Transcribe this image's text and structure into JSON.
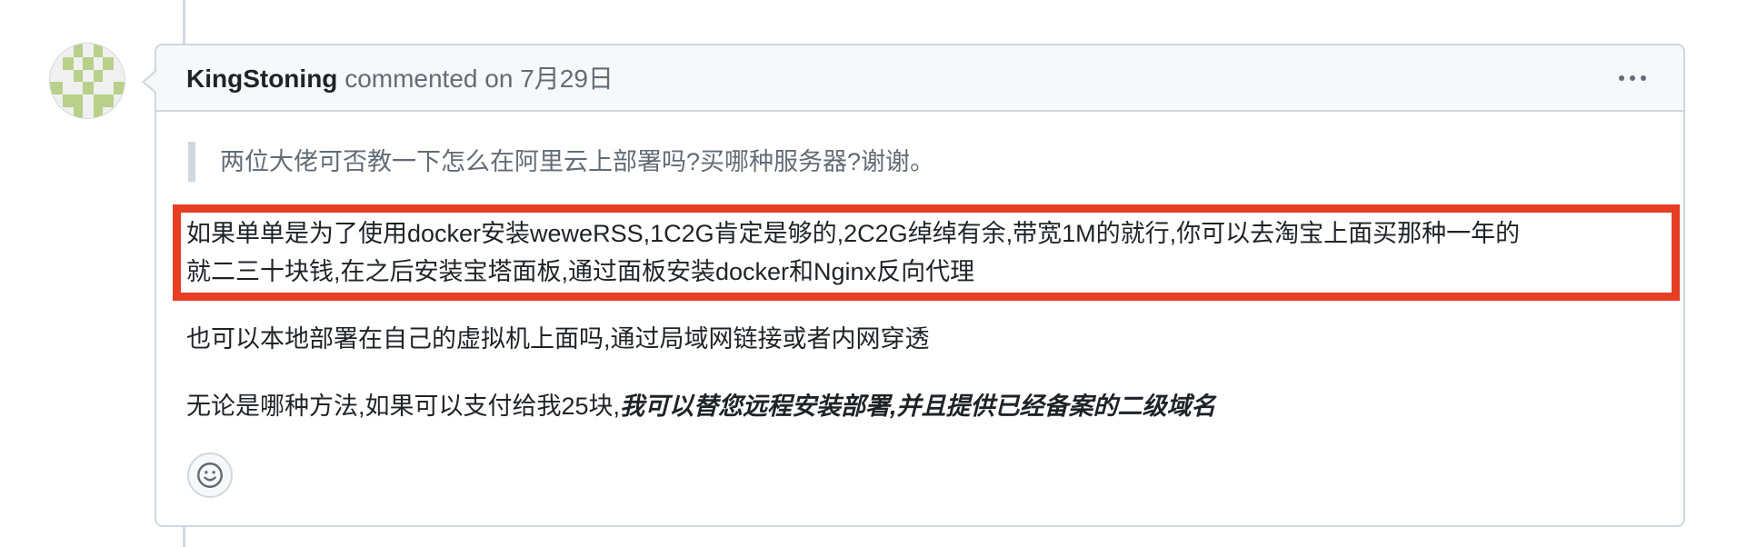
{
  "comment": {
    "author": "KingStoning",
    "action": "commented",
    "date_prefix": "on",
    "date": "7月29日",
    "quote": "两位大佬可否教一下怎么在阿里云上部署吗?买哪种服务器?谢谢。",
    "body": {
      "para1_line1": "如果单单是为了使用docker安装weweRSS,1C2G肯定是够的,2C2G绰绰有余,带宽1M的就行,你可以去淘宝上面买那种一年的",
      "para1_line2": "就二三十块钱,在之后安装宝塔面板,通过面板安装docker和Nginx反向代理",
      "para2": "也可以本地部署在自己的虚拟机上面吗,通过局域网链接或者内网穿透",
      "para3_plain": "无论是哪种方法,如果可以支付给我25块,",
      "para3_emphasis": "我可以替您远程安装部署,并且提供已经备案的二级域名"
    }
  },
  "icons": {
    "more": "kebab-horizontal-icon",
    "reaction": "smiley-icon",
    "avatar": "identicon-avatar"
  },
  "colors": {
    "highlight_border": "#e63e24",
    "header_bg": "#f6f8fa",
    "border": "#d0d7de",
    "muted_text": "#636c76",
    "avatar_green": "#b8d08a"
  }
}
